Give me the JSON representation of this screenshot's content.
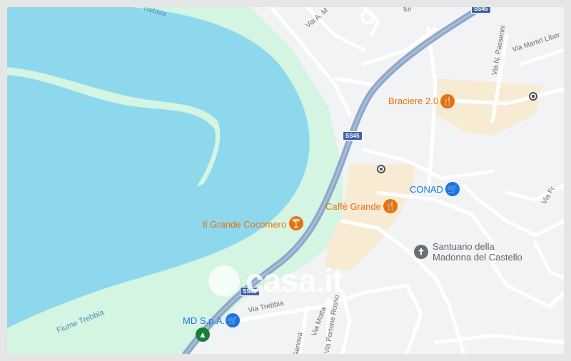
{
  "map": {
    "colors": {
      "water": "#8ed8ee",
      "park": "#d4f5e2",
      "road": "#ffffff",
      "highway": "#8ea6c9",
      "urban": "#f7ebd4",
      "background": "#f1f3f4"
    },
    "labels": {
      "trebbia_top": "Trebbia",
      "via_a_m": "Via A. M",
      "via_n_passerini": "Via N. Passerini",
      "via_martiri_liber": "Via Martiri Liber",
      "via_fr": "Via Fr",
      "via_trebbia": "Via Trebbia",
      "via_motta": "Via Motta",
      "via_portone_rosso": "Via Portone Rosso",
      "genova": "Genova",
      "fiume_trebbia": "Fiume Trebbia",
      "top_fragment": "tur"
    },
    "route_shields": [
      "SS45",
      "SS45",
      "SS45"
    ],
    "pois": [
      {
        "name": "Braciere 2.0",
        "icon": "restaurant-icon",
        "color": "#e8710a"
      },
      {
        "name": "CONAD",
        "icon": "shopping-cart-icon",
        "color": "#1a73e8"
      },
      {
        "name": "Caffè Grande",
        "icon": "restaurant-icon",
        "color": "#e8710a"
      },
      {
        "name": "Il Grande Cocomero",
        "icon": "bar-icon",
        "color": "#e8710a"
      },
      {
        "name": "Santuario della\nMadonna del Castello",
        "icon": "church-icon",
        "color": "#5f6368"
      },
      {
        "name": "MD S.p.A.",
        "icon": "shopping-cart-icon",
        "color": "#1a73e8"
      }
    ],
    "extra_icons": [
      "bus-station-icon",
      "bus-station-icon",
      "park-triangle-icon"
    ],
    "watermark": "casa.it"
  }
}
